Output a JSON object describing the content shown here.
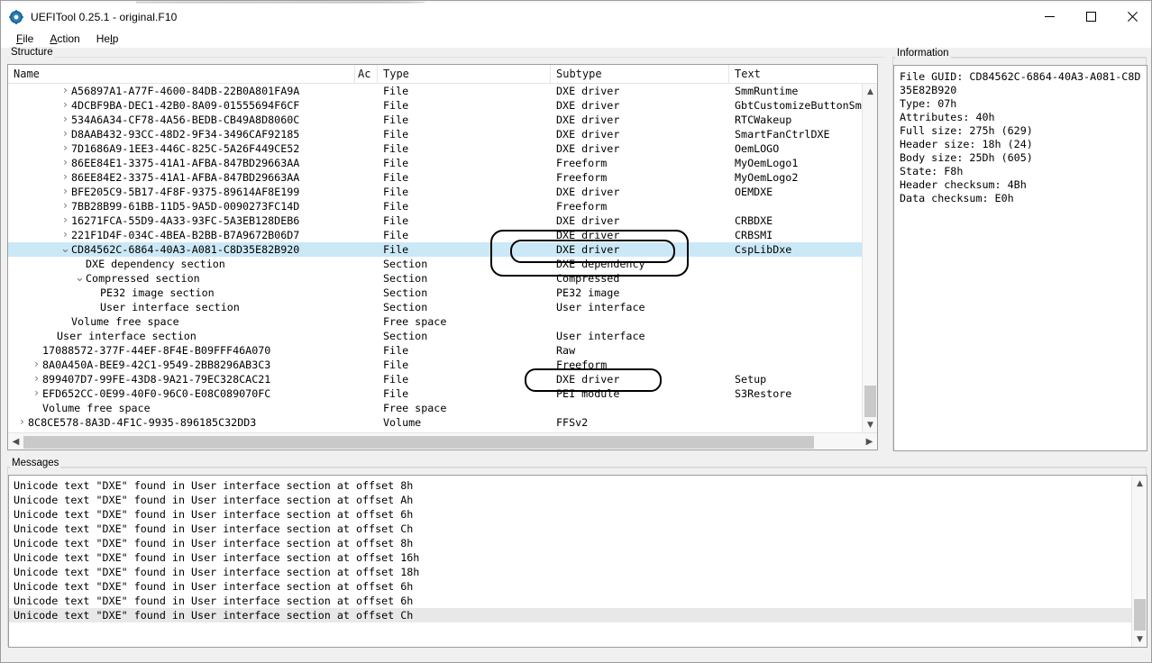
{
  "window": {
    "title": "UEFITool 0.25.1 - original.F10",
    "icon": "uefitool-gear-icon",
    "controls": {
      "minimize": "—",
      "maximize": "☐",
      "close": "✕"
    }
  },
  "menu": {
    "items": [
      {
        "label": "File",
        "mnemonic": "F"
      },
      {
        "label": "Action",
        "mnemonic": "A"
      },
      {
        "label": "Help",
        "mnemonic": "H"
      }
    ]
  },
  "structure": {
    "group_title": "Structure",
    "columns": [
      "Name",
      "Ac",
      "Type",
      "Subtype",
      "Text"
    ],
    "rows": [
      {
        "name": "A56897A1-A77F-4600-84DB-22B0A801FA9A",
        "indent": 4,
        "chev": "collapsed",
        "ac": "",
        "type": "File",
        "subtype": "DXE driver",
        "text": "SmmRuntime"
      },
      {
        "name": "4DCBF9BA-DEC1-42B0-8A09-01555694F6CF",
        "indent": 4,
        "chev": "collapsed",
        "ac": "",
        "type": "File",
        "subtype": "DXE driver",
        "text": "GbtCustomizeButtonSmm"
      },
      {
        "name": "534A6A34-CF78-4A56-BEDB-CB49A8D8060C",
        "indent": 4,
        "chev": "collapsed",
        "ac": "",
        "type": "File",
        "subtype": "DXE driver",
        "text": "RTCWakeup"
      },
      {
        "name": "D8AAB432-93CC-48D2-9F34-3496CAF92185",
        "indent": 4,
        "chev": "collapsed",
        "ac": "",
        "type": "File",
        "subtype": "DXE driver",
        "text": "SmartFanCtrlDXE"
      },
      {
        "name": "7D1686A9-1EE3-446C-825C-5A26F449CE52",
        "indent": 4,
        "chev": "collapsed",
        "ac": "",
        "type": "File",
        "subtype": "DXE driver",
        "text": "OemLOGO"
      },
      {
        "name": "86EE84E1-3375-41A1-AFBA-847BD29663AA",
        "indent": 4,
        "chev": "collapsed",
        "ac": "",
        "type": "File",
        "subtype": "Freeform",
        "text": "MyOemLogo1"
      },
      {
        "name": "86EE84E2-3375-41A1-AFBA-847BD29663AA",
        "indent": 4,
        "chev": "collapsed",
        "ac": "",
        "type": "File",
        "subtype": "Freeform",
        "text": "MyOemLogo2"
      },
      {
        "name": "BFE205C9-5B17-4F8F-9375-89614AF8E199",
        "indent": 4,
        "chev": "collapsed",
        "ac": "",
        "type": "File",
        "subtype": "DXE driver",
        "text": "OEMDXE"
      },
      {
        "name": "7BB28B99-61BB-11D5-9A5D-0090273FC14D",
        "indent": 4,
        "chev": "collapsed",
        "ac": "",
        "type": "File",
        "subtype": "Freeform",
        "text": ""
      },
      {
        "name": "16271FCA-55D9-4A33-93FC-5A3EB128DEB6",
        "indent": 4,
        "chev": "collapsed",
        "ac": "",
        "type": "File",
        "subtype": "DXE driver",
        "text": "CRBDXE"
      },
      {
        "name": "221F1D4F-034C-4BEA-B2BB-B7A9672B06D7",
        "indent": 4,
        "chev": "collapsed",
        "ac": "",
        "type": "File",
        "subtype": "DXE driver",
        "text": "CRBSMI"
      },
      {
        "name": "CD84562C-6864-40A3-A081-C8D35E82B920",
        "indent": 4,
        "chev": "expanded",
        "ac": "",
        "type": "File",
        "subtype": "DXE driver",
        "text": "CspLibDxe",
        "selected": true
      },
      {
        "name": "DXE dependency section",
        "indent": 5,
        "chev": "none",
        "ac": "",
        "type": "Section",
        "subtype": "DXE dependency",
        "text": ""
      },
      {
        "name": "Compressed section",
        "indent": 5,
        "chev": "expanded",
        "ac": "",
        "type": "Section",
        "subtype": "Compressed",
        "text": ""
      },
      {
        "name": "PE32 image section",
        "indent": 6,
        "chev": "none",
        "ac": "",
        "type": "Section",
        "subtype": "PE32 image",
        "text": ""
      },
      {
        "name": "User interface section",
        "indent": 6,
        "chev": "none",
        "ac": "",
        "type": "Section",
        "subtype": "User interface",
        "text": ""
      },
      {
        "name": "Volume free space",
        "indent": 4,
        "chev": "none",
        "ac": "",
        "type": "Free space",
        "subtype": "",
        "text": ""
      },
      {
        "name": "User interface section",
        "indent": 3,
        "chev": "none",
        "ac": "",
        "type": "Section",
        "subtype": "User interface",
        "text": ""
      },
      {
        "name": "17088572-377F-44EF-8F4E-B09FFF46A070",
        "indent": 2,
        "chev": "none",
        "ac": "",
        "type": "File",
        "subtype": "Raw",
        "text": ""
      },
      {
        "name": "8A0A450A-BEE9-42C1-9549-2BB8296AB3C3",
        "indent": 2,
        "chev": "collapsed",
        "ac": "",
        "type": "File",
        "subtype": "Freeform",
        "text": ""
      },
      {
        "name": "899407D7-99FE-43D8-9A21-79EC328CAC21",
        "indent": 2,
        "chev": "collapsed",
        "ac": "",
        "type": "File",
        "subtype": "DXE driver",
        "text": "Setup"
      },
      {
        "name": "EFD652CC-0E99-40F0-96C0-E08C089070FC",
        "indent": 2,
        "chev": "collapsed",
        "ac": "",
        "type": "File",
        "subtype": "PEI module",
        "text": "S3Restore"
      },
      {
        "name": "Volume free space",
        "indent": 2,
        "chev": "none",
        "ac": "",
        "type": "Free space",
        "subtype": "",
        "text": ""
      },
      {
        "name": "8C8CE578-8A3D-4F1C-9935-896185C32DD3",
        "indent": 1,
        "chev": "collapsed",
        "ac": "",
        "type": "Volume",
        "subtype": "FFSv2",
        "text": ""
      }
    ]
  },
  "information": {
    "group_title": "Information",
    "body": "File GUID: CD84562C-6864-40A3-A081-C8D35E82B920\nType: 07h\nAttributes: 40h\nFull size: 275h (629)\nHeader size: 18h (24)\nBody size: 25Dh (605)\nState: F8h\nHeader checksum: 4Bh\nData checksum: E0h"
  },
  "messages": {
    "group_title": "Messages",
    "lines": [
      {
        "text": "Unicode text \"DXE\" found in User interface section at offset 8h"
      },
      {
        "text": "Unicode text \"DXE\" found in User interface section at offset Ah"
      },
      {
        "text": "Unicode text \"DXE\" found in User interface section at offset 6h"
      },
      {
        "text": "Unicode text \"DXE\" found in User interface section at offset Ch"
      },
      {
        "text": "Unicode text \"DXE\" found in User interface section at offset 8h"
      },
      {
        "text": "Unicode text \"DXE\" found in User interface section at offset 16h"
      },
      {
        "text": "Unicode text \"DXE\" found in User interface section at offset 18h"
      },
      {
        "text": "Unicode text \"DXE\" found in User interface section at offset 6h"
      },
      {
        "text": "Unicode text \"DXE\" found in User interface section at offset 6h"
      },
      {
        "text": "Unicode text \"DXE\" found in User interface section at offset Ch",
        "highlighted": true
      }
    ]
  },
  "annotations": [
    {
      "id": "outer-highlight",
      "targets": "DXE driver / DXE driver / DXE dependency subtypes"
    },
    {
      "id": "inner-highlight",
      "targets": "DXE driver subtype of selected row"
    },
    {
      "id": "lower-highlight",
      "targets": "DXE driver subtype of Setup row"
    }
  ],
  "colors": {
    "selection": "#cbe8f6",
    "message_highlight": "#e8e8e8",
    "annotation_stroke": "#000000",
    "window_bg": "#f0f0f0",
    "panel_bg": "#ffffff"
  }
}
